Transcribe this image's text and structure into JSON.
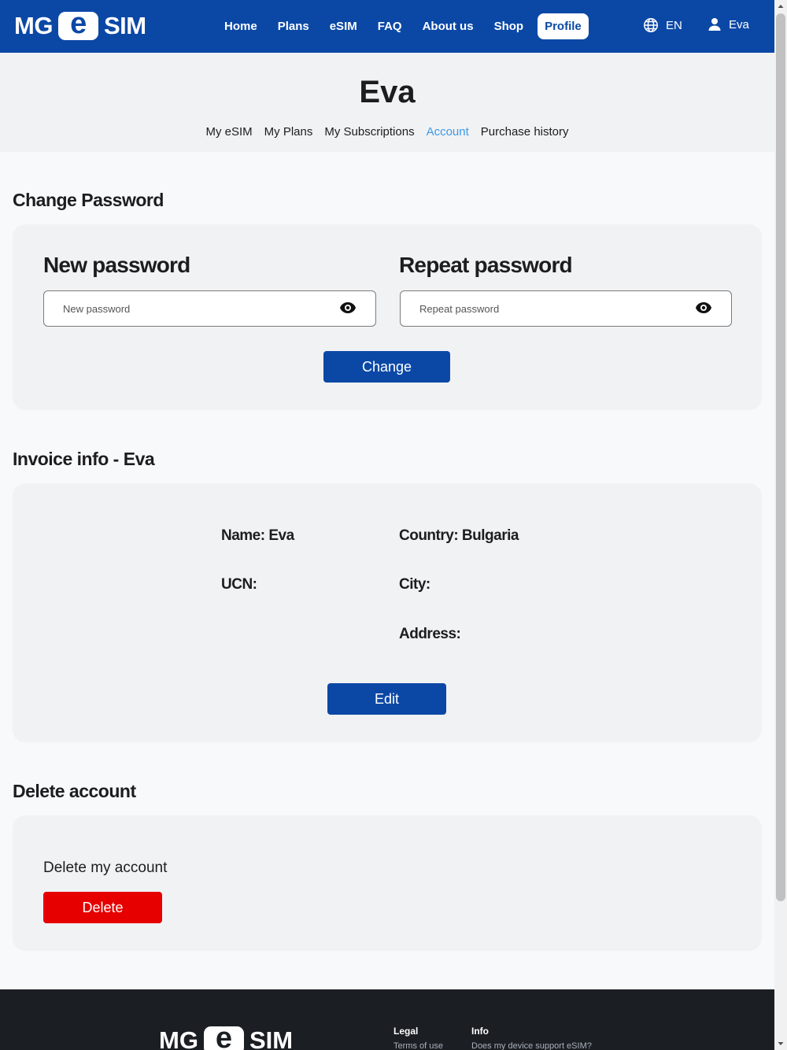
{
  "brand": {
    "logo_left": "MG",
    "logo_e": "e",
    "logo_right": "SIM"
  },
  "nav": {
    "items": [
      "Home",
      "Plans",
      "eSIM",
      "FAQ",
      "About us",
      "Shop"
    ],
    "active": "Profile",
    "language": "EN",
    "user": "Eva"
  },
  "profile": {
    "name": "Eva",
    "tabs": [
      "My eSIM",
      "My Plans",
      "My Subscriptions",
      "Account",
      "Purchase history"
    ],
    "active_tab": "Account"
  },
  "change_password": {
    "title": "Change Password",
    "new_label": "New password",
    "new_placeholder": "New password",
    "repeat_label": "Repeat password",
    "repeat_placeholder": "Repeat password",
    "button": "Change"
  },
  "invoice": {
    "title": "Invoice info - Eva",
    "name": "Name: Eva",
    "ucn": "UCN:",
    "country": "Country: Bulgaria",
    "city": "City:",
    "address": "Address:",
    "button": "Edit"
  },
  "delete_account": {
    "title": "Delete account",
    "text": "Delete my account",
    "button": "Delete"
  },
  "footer": {
    "legal_title": "Legal",
    "legal_link": "Terms of use",
    "info_title": "Info",
    "info_link": "Does my device support eSIM?"
  },
  "colors": {
    "primary": "#0b48a6",
    "danger": "#e60000",
    "accent_tab": "#3c9ae8",
    "footer": "#1b1e22"
  }
}
